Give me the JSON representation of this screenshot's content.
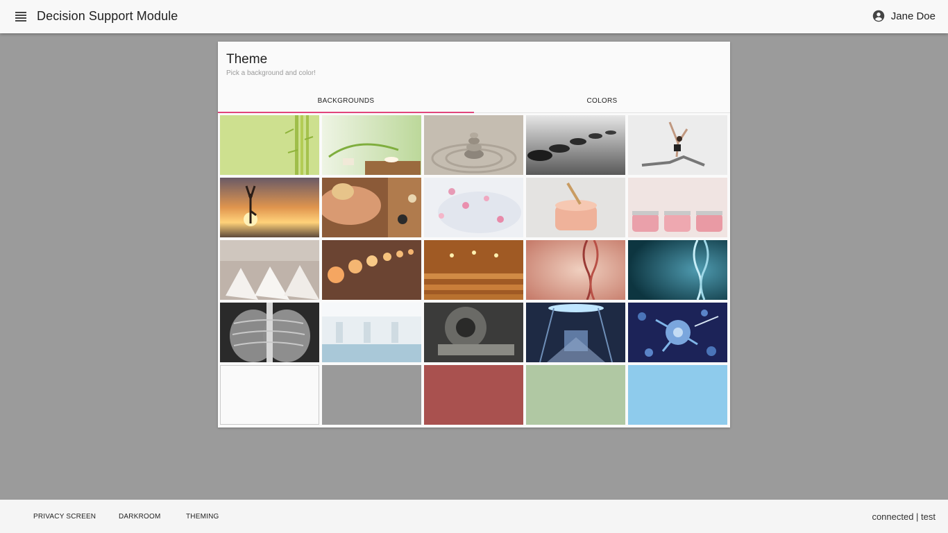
{
  "header": {
    "title": "Decision Support Module",
    "menu_icon": "menu-icon",
    "user_icon": "account-circle-icon",
    "user_name": "Jane Doe"
  },
  "theme_card": {
    "title": "Theme",
    "subtitle": "Pick a background and color!",
    "tabs": [
      {
        "label": "BACKGROUNDS",
        "active": true
      },
      {
        "label": "COLORS",
        "active": false
      }
    ],
    "accent_color": "#e0457b"
  },
  "backgrounds": [
    {
      "name": "bamboo",
      "kind": "photo"
    },
    {
      "name": "spa-bamboo-leaves",
      "kind": "photo"
    },
    {
      "name": "zen-stones-sand",
      "kind": "photo"
    },
    {
      "name": "black-stones-water",
      "kind": "photo"
    },
    {
      "name": "yoga-pose",
      "kind": "photo"
    },
    {
      "name": "yoga-sunset",
      "kind": "photo"
    },
    {
      "name": "massage",
      "kind": "photo"
    },
    {
      "name": "flower-bath",
      "kind": "photo"
    },
    {
      "name": "cream-jar",
      "kind": "photo"
    },
    {
      "name": "pink-jars",
      "kind": "photo"
    },
    {
      "name": "spa-loungers",
      "kind": "photo"
    },
    {
      "name": "candles",
      "kind": "photo"
    },
    {
      "name": "sauna",
      "kind": "photo"
    },
    {
      "name": "dna-warm",
      "kind": "photo"
    },
    {
      "name": "dna-teal",
      "kind": "photo"
    },
    {
      "name": "chest-xray",
      "kind": "photo"
    },
    {
      "name": "hospital-room",
      "kind": "photo"
    },
    {
      "name": "mri-room",
      "kind": "photo"
    },
    {
      "name": "sci-fi-lab",
      "kind": "photo"
    },
    {
      "name": "cell-injection",
      "kind": "photo"
    },
    {
      "name": "white",
      "kind": "color",
      "color": "#fafafa"
    },
    {
      "name": "gray",
      "kind": "color",
      "color": "#9a9a9a"
    },
    {
      "name": "red",
      "kind": "color",
      "color": "#a9514f"
    },
    {
      "name": "sage-green",
      "kind": "color",
      "color": "#b0c8a3"
    },
    {
      "name": "sky-blue",
      "kind": "color",
      "color": "#8ecbec"
    }
  ],
  "footer": {
    "buttons": [
      "PRIVACY SCREEN",
      "DARKROOM",
      "THEMING"
    ],
    "status": "connected | test"
  },
  "colors": {
    "page_background": "#9b9b9b",
    "app_bar": "#f8f8f8",
    "footer": "#f5f5f5"
  }
}
